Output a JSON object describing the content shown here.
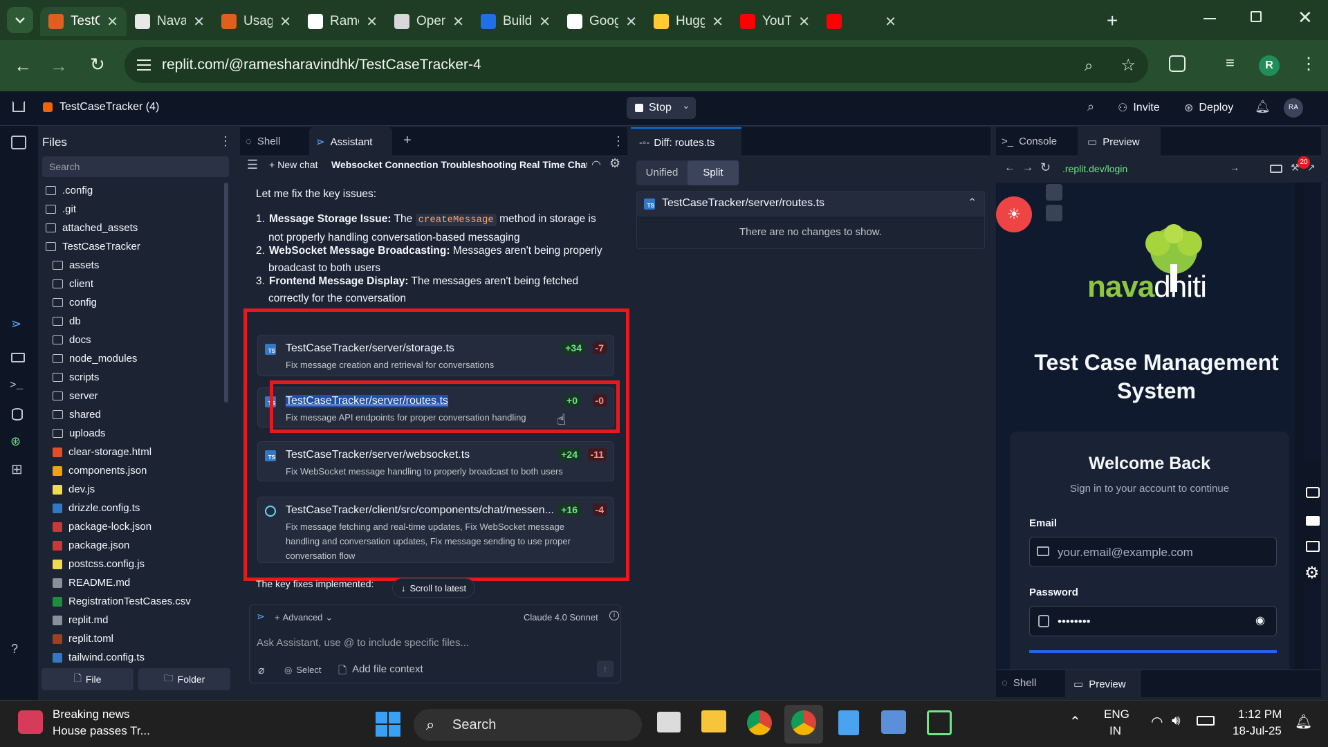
{
  "browser": {
    "tabs": [
      {
        "title": "TestC",
        "fav": "#e05f1f"
      },
      {
        "title": "Naval",
        "fav": "#e8e8e8"
      },
      {
        "title": "Usage",
        "fav": "#e05f1f"
      },
      {
        "title": "Rame",
        "fav": "#ffffff"
      },
      {
        "title": "Open",
        "fav": "#d8d8d8"
      },
      {
        "title": "Build",
        "fav": "#1f6feb"
      },
      {
        "title": "Goog",
        "fav": "#ffffff"
      },
      {
        "title": "Hugg",
        "fav": "#ffcc33"
      },
      {
        "title": "YouTu",
        "fav": "#ff0000"
      },
      {
        "title": "",
        "fav": "#ff0000"
      }
    ],
    "url": "replit.com/@ramesharavindhk/TestCaseTracker-4",
    "profile_initial": "R"
  },
  "replit": {
    "project": "TestCaseTracker (4)",
    "stop": "Stop",
    "invite": "Invite",
    "deploy": "Deploy",
    "avatar": "RA"
  },
  "files": {
    "title": "Files",
    "search_placeholder": "Search",
    "items": [
      {
        "name": ".config",
        "type": "folder",
        "indent": 0
      },
      {
        "name": ".git",
        "type": "folder",
        "indent": 0
      },
      {
        "name": "attached_assets",
        "type": "folder",
        "indent": 0
      },
      {
        "name": "TestCaseTracker",
        "type": "folder",
        "indent": 0
      },
      {
        "name": "assets",
        "type": "folder",
        "indent": 1
      },
      {
        "name": "client",
        "type": "folder",
        "indent": 1
      },
      {
        "name": "config",
        "type": "folder",
        "indent": 1
      },
      {
        "name": "db",
        "type": "folder",
        "indent": 1
      },
      {
        "name": "docs",
        "type": "folder",
        "indent": 1
      },
      {
        "name": "node_modules",
        "type": "folder",
        "indent": 1
      },
      {
        "name": "scripts",
        "type": "folder",
        "indent": 1
      },
      {
        "name": "server",
        "type": "folder",
        "indent": 1
      },
      {
        "name": "shared",
        "type": "folder",
        "indent": 1
      },
      {
        "name": "uploads",
        "type": "folder",
        "indent": 1
      },
      {
        "name": "clear-storage.html",
        "type": "html",
        "indent": 1
      },
      {
        "name": "components.json",
        "type": "json",
        "indent": 1
      },
      {
        "name": "dev.js",
        "type": "js",
        "indent": 1
      },
      {
        "name": "drizzle.config.ts",
        "type": "ts",
        "indent": 1
      },
      {
        "name": "package-lock.json",
        "type": "npm",
        "indent": 1
      },
      {
        "name": "package.json",
        "type": "npm",
        "indent": 1
      },
      {
        "name": "postcss.config.js",
        "type": "js",
        "indent": 1
      },
      {
        "name": "README.md",
        "type": "md",
        "indent": 1
      },
      {
        "name": "RegistrationTestCases.csv",
        "type": "csv",
        "indent": 1
      },
      {
        "name": "replit.md",
        "type": "md",
        "indent": 1
      },
      {
        "name": "replit.toml",
        "type": "toml",
        "indent": 1
      },
      {
        "name": "tailwind.config.ts",
        "type": "ts",
        "indent": 1
      }
    ],
    "new_file": "File",
    "new_folder": "Folder"
  },
  "assistant": {
    "tab_shell": "Shell",
    "tab_assistant": "Assistant",
    "new_chat": "New chat",
    "chat_title": "Websocket Connection Troubleshooting Real Time Chat ...",
    "intro": "Let me fix the key issues:",
    "issues": [
      {
        "num": "1.",
        "bold": "Message Storage Issue:",
        "pre": " The ",
        "code": "createMessage",
        "post": " method in storage is",
        "line2": "not properly handling conversation-based messaging"
      },
      {
        "num": "2.",
        "bold": "WebSocket Message Broadcasting:",
        "pre": " Messages aren't being properly",
        "code": "",
        "post": "",
        "line2": "broadcast to both users"
      },
      {
        "num": "3.",
        "bold": "Frontend Message Display:",
        "pre": " The messages aren't being fetched",
        "code": "",
        "post": "",
        "line2": "correctly for the conversation"
      }
    ],
    "changes": [
      {
        "path": "TestCaseTracker/server/storage.ts",
        "add": "+34",
        "del": "-7",
        "desc": "Fix message creation and retrieval for conversations"
      },
      {
        "path": "TestCaseTracker/server/routes.ts",
        "add": "+0",
        "del": "-0",
        "desc": "Fix message API endpoints for proper conversation handling"
      },
      {
        "path": "TestCaseTracker/server/websocket.ts",
        "add": "+24",
        "del": "-11",
        "desc": "Fix WebSocket message handling to properly broadcast to both users"
      },
      {
        "path": "TestCaseTracker/client/src/components/chat/messen...",
        "add": "+16",
        "del": "-4",
        "desc": "Fix message fetching and real-time updates, Fix WebSocket message handling and conversation updates, Fix message sending to use proper conversation flow"
      }
    ],
    "footer_text": "The key fixes implemented:",
    "scroll_latest": "Scroll to latest",
    "advanced": "Advanced",
    "model": "Claude 4.0 Sonnet",
    "input_placeholder": "Ask Assistant, use @ to include specific files...",
    "select": "Select",
    "add_context": "Add file context"
  },
  "diff": {
    "tab": "Diff: routes.ts",
    "unified": "Unified",
    "split": "Split",
    "file": "TestCaseTracker/server/routes.ts",
    "empty": "There are no changes to show."
  },
  "preview": {
    "tab_console": "Console",
    "tab_preview": "Preview",
    "url": ".replit.dev/login",
    "badge": "20",
    "logo_text_a": "nava",
    "logo_text_b": "dhiti",
    "heading": "Test Case Management System",
    "welcome": "Welcome Back",
    "subtitle": "Sign in to your account to continue",
    "email_label": "Email",
    "email_placeholder": "your.email@example.com",
    "password_label": "Password",
    "password_value": "••••••••",
    "bottom_shell": "Shell",
    "bottom_preview": "Preview"
  },
  "taskbar": {
    "news_title": "Breaking news",
    "news_sub": "House passes Tr...",
    "search": "Search",
    "lang1": "ENG",
    "lang2": "IN",
    "time": "1:12 PM",
    "date": "18-Jul-25"
  }
}
